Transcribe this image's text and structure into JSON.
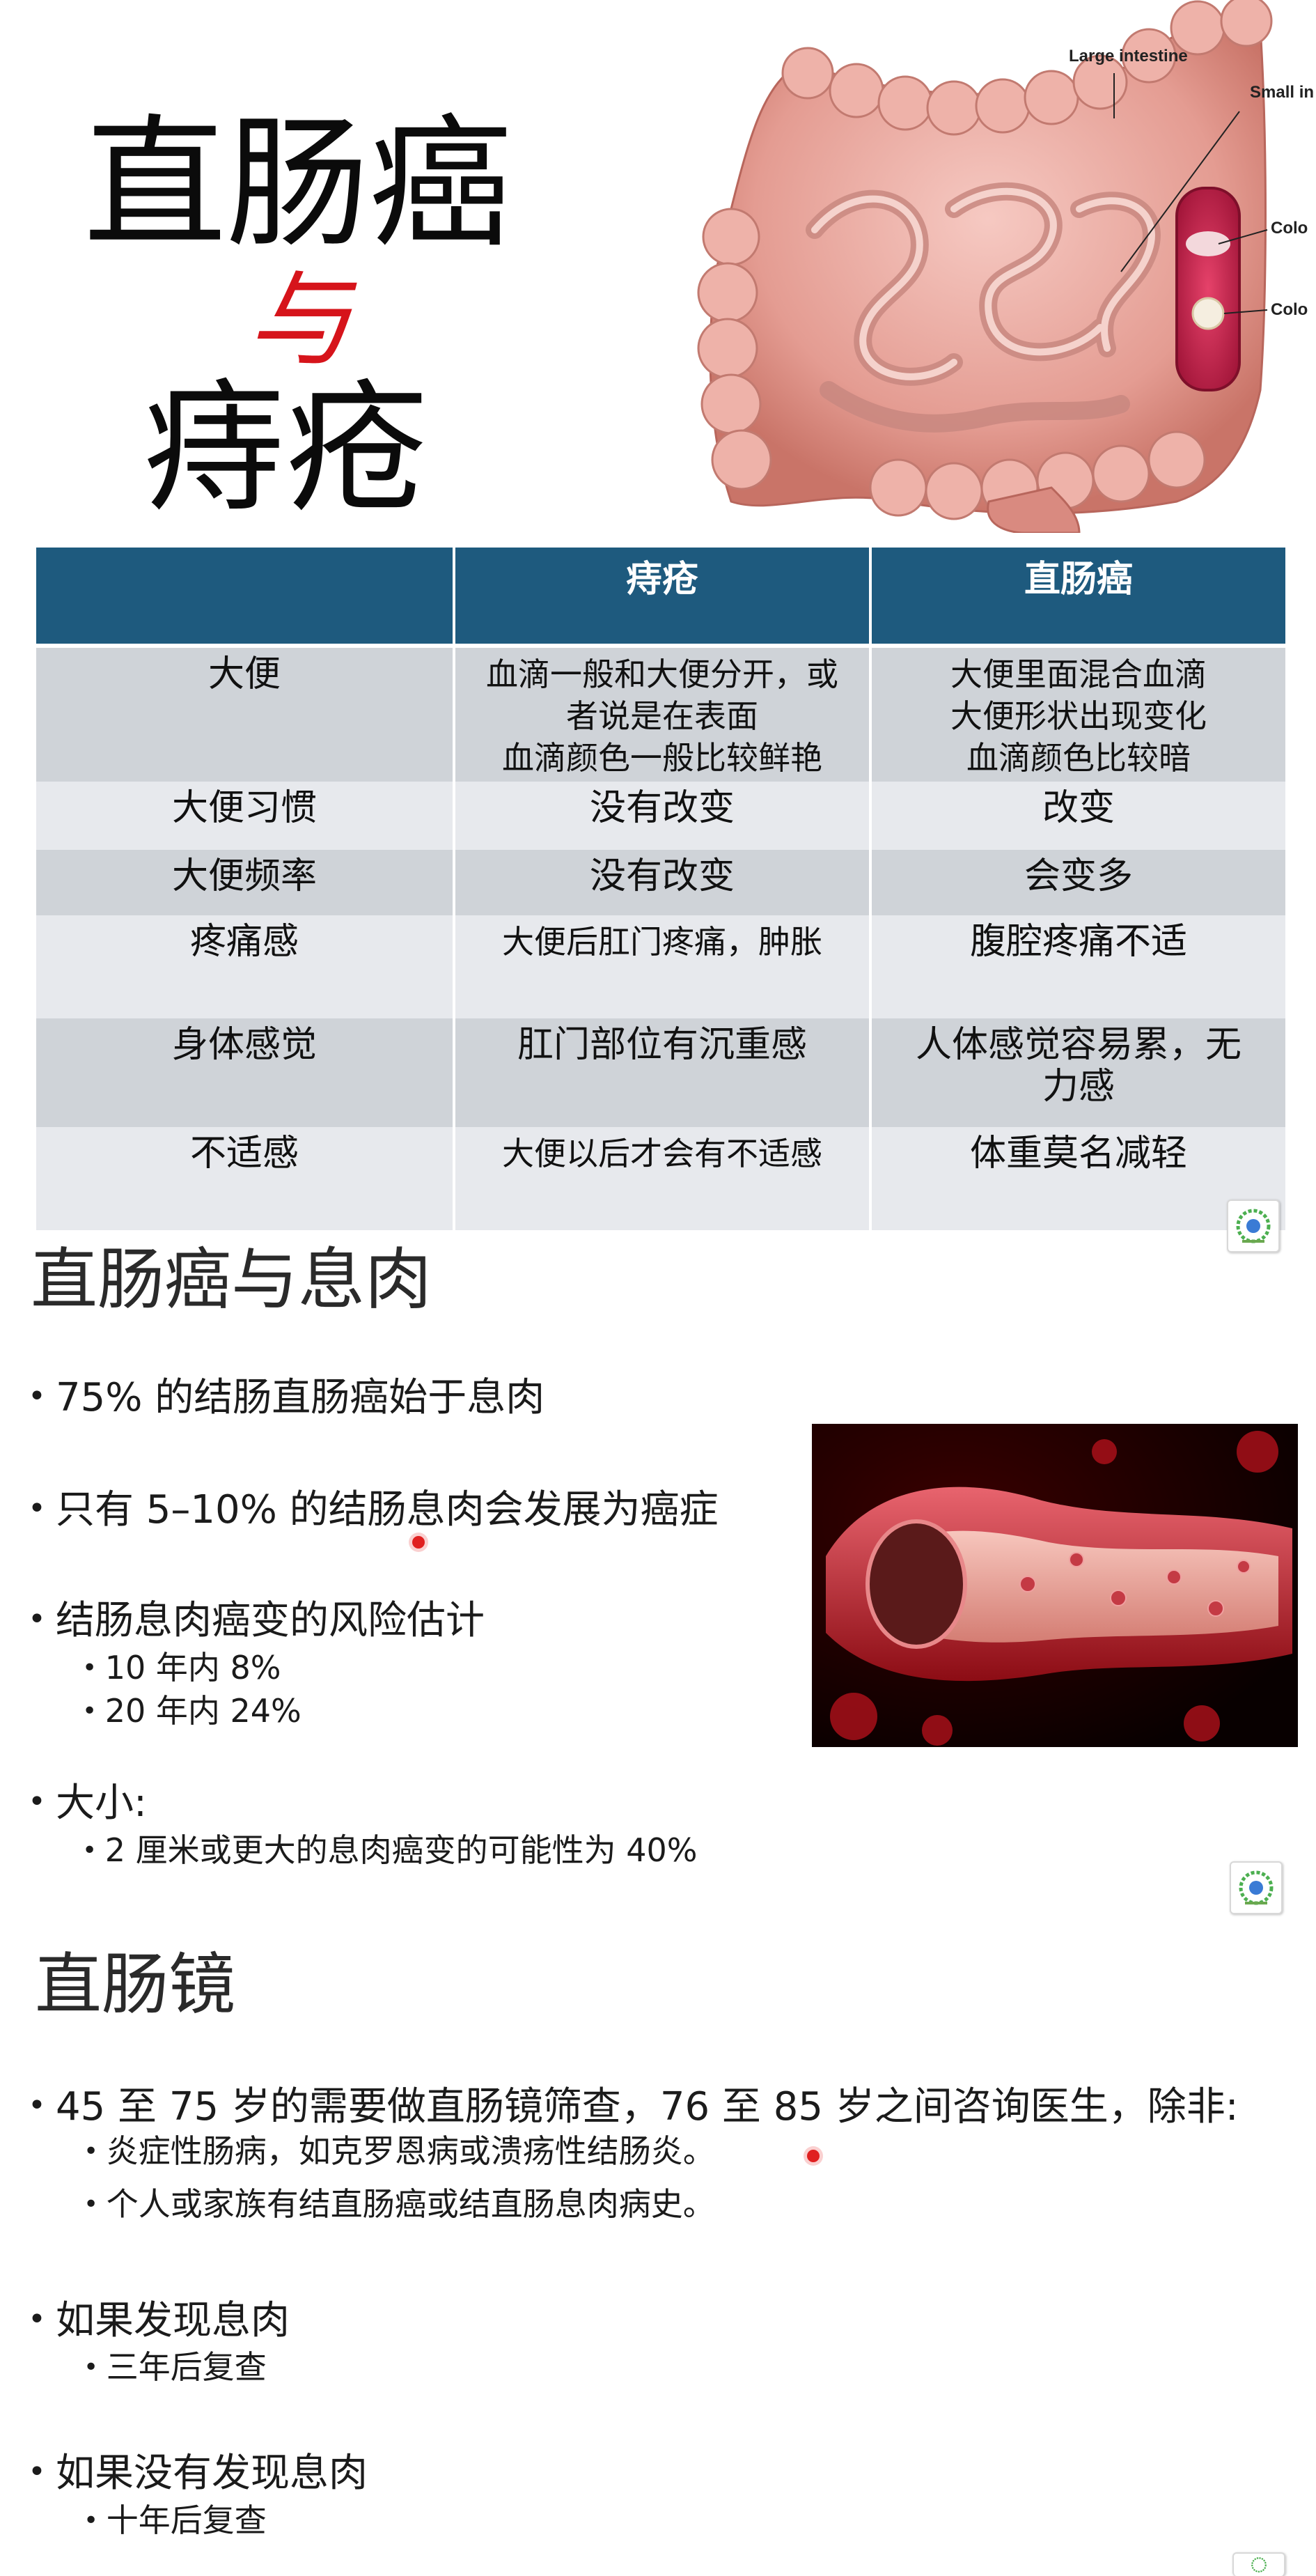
{
  "slide1": {
    "title_main": "直肠癌",
    "title_conj": "与",
    "title_sub": "痔疮",
    "anatomy_labels": {
      "large_intestine": "Large intestine",
      "small_intestine": "Small in",
      "colon_1": "Colo",
      "colon_2": "Colo"
    },
    "table": {
      "header": [
        "",
        "痔疮",
        "直肠癌"
      ],
      "rows": [
        {
          "label": "大便",
          "hemorrhoids": "血滴一般和大便分开，或\n者说是在表面\n血滴颜色一般比较鲜艳",
          "cancer": "大便里面混合血滴\n大便形状出现变化\n血滴颜色比较暗"
        },
        {
          "label": "大便习惯",
          "hemorrhoids": "没有改变",
          "cancer": "改变"
        },
        {
          "label": "大便频率",
          "hemorrhoids": "没有改变",
          "cancer": "会变多"
        },
        {
          "label": "疼痛感",
          "hemorrhoids": "大便后肛门疼痛，肿胀",
          "cancer": "腹腔疼痛不适"
        },
        {
          "label": "身体感觉",
          "hemorrhoids": "肛门部位有沉重感",
          "cancer": "人体感觉容易累，无\n力感"
        },
        {
          "label": "不适感",
          "hemorrhoids": "大便以后才会有不适感",
          "cancer": "体重莫名减轻"
        }
      ]
    }
  },
  "slide2": {
    "heading": "直肠癌与息肉",
    "bullets": [
      "75% 的结肠直肠癌始于息肉",
      "只有 5–10% 的结肠息肉会发展为癌症",
      "结肠息肉癌变的风险估计",
      "大小:"
    ],
    "sub_bullets": [
      "10 年内 8%",
      "20 年内 24%",
      "2 厘米或更大的息肉癌变的可能性为 40%"
    ]
  },
  "slide3": {
    "heading": "直肠镜",
    "bullets": [
      "45 至 75 岁的需要做直肠镜筛查，76 至 85 岁之间咨询医生，除非:",
      "如果发现息肉",
      "如果没有发现息肉"
    ],
    "sub_bullets": [
      "炎症性肠病，如克罗恩病或溃疡性结肠炎。",
      "个人或家族有结直肠癌或结直肠息肉病史。",
      "三年后复查",
      "十年后复查"
    ]
  },
  "icons": {
    "logo": "hospital-logo-icon",
    "pointer": "laser-pointer-dot"
  },
  "colors": {
    "table_header": "#1e5a7e",
    "row_dark": "#cfd3d8",
    "row_light": "#e7e9ed",
    "title_accent": "#d6141b",
    "pointer": "#e02020"
  }
}
